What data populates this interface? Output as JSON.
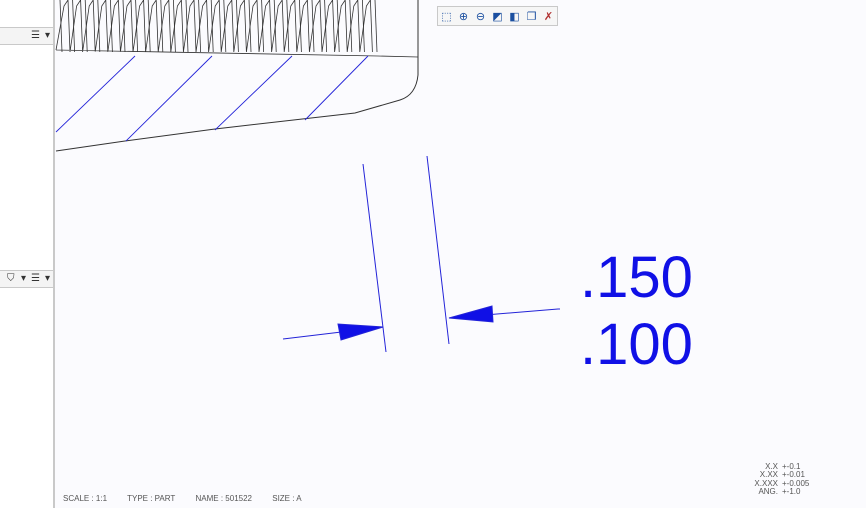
{
  "left_panel": {
    "top_toolbar": {
      "icon": "list-icon",
      "dropdown": "▾"
    },
    "mid_toolbar": {
      "icon1": "filter-icon",
      "icon2": "list-icon",
      "dropdown": "▾"
    }
  },
  "view_toolbar": {
    "buttons": [
      {
        "name": "refit-icon",
        "glyph": "⬚"
      },
      {
        "name": "zoom-in-icon",
        "glyph": "⊕"
      },
      {
        "name": "zoom-out-icon",
        "glyph": "⊖"
      },
      {
        "name": "repaint-icon",
        "glyph": "◩"
      },
      {
        "name": "display-style-icon",
        "glyph": "◧"
      },
      {
        "name": "saved-views-icon",
        "glyph": "❐"
      },
      {
        "name": "datum-display-icon",
        "glyph": "✗"
      }
    ]
  },
  "dimension": {
    "upper": ".150",
    "lower": ".100",
    "color": "#1010e6"
  },
  "status": {
    "scale": "SCALE : 1:1",
    "type": "TYPE : PART",
    "name": "NAME : 501522",
    "size": "SIZE : A"
  },
  "tolerance": [
    {
      "label": "X.X",
      "value": "+-0.1"
    },
    {
      "label": "X.XX",
      "value": "+-0.01"
    },
    {
      "label": "X.XXX",
      "value": "+-0.005"
    },
    {
      "label": "ANG.",
      "value": "+-1.0"
    }
  ]
}
